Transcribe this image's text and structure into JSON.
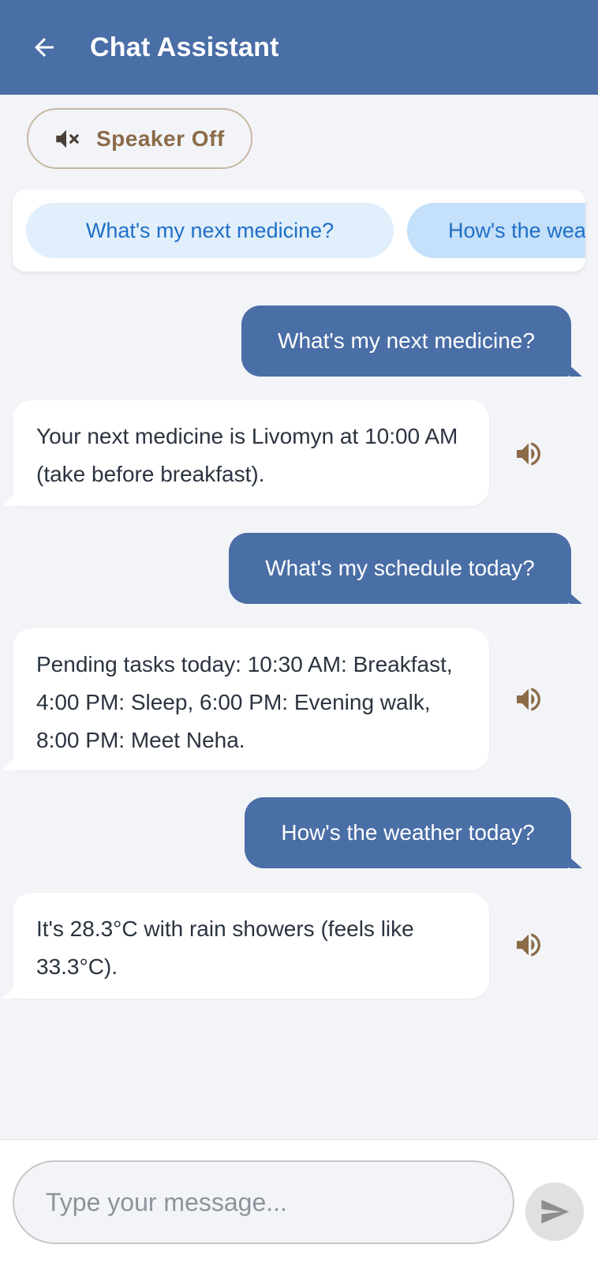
{
  "header": {
    "title": "Chat Assistant",
    "back_icon": "arrow-left-icon",
    "background": "#4a6ea6"
  },
  "speaker_toggle": {
    "label": "Speaker Off",
    "icon": "speaker-off-icon",
    "accent": "#8b6b48"
  },
  "suggestions": [
    {
      "label": "What's my next medicine?"
    },
    {
      "label": "How's the wea"
    }
  ],
  "messages": [
    {
      "from": "user",
      "text": "What's my next medicine?"
    },
    {
      "from": "assistant",
      "text": "Your next medicine is Livomyn at 10:00 AM (take before breakfast).",
      "icon": "volume-icon"
    },
    {
      "from": "user",
      "text": "What's my schedule today?"
    },
    {
      "from": "assistant",
      "text": "Pending tasks today: 10:30 AM: Breakfast, 4:00 PM: Sleep, 6:00 PM: Evening walk, 8:00 PM: Meet Neha.",
      "icon": "volume-icon"
    },
    {
      "from": "user",
      "text": "How's the weather today?"
    },
    {
      "from": "assistant",
      "text": "It's 28.3°C with rain showers (feels like 33.3°C).",
      "icon": "volume-icon"
    }
  ],
  "composer": {
    "placeholder": "Type your message...",
    "value": "",
    "send_icon": "send-icon"
  }
}
